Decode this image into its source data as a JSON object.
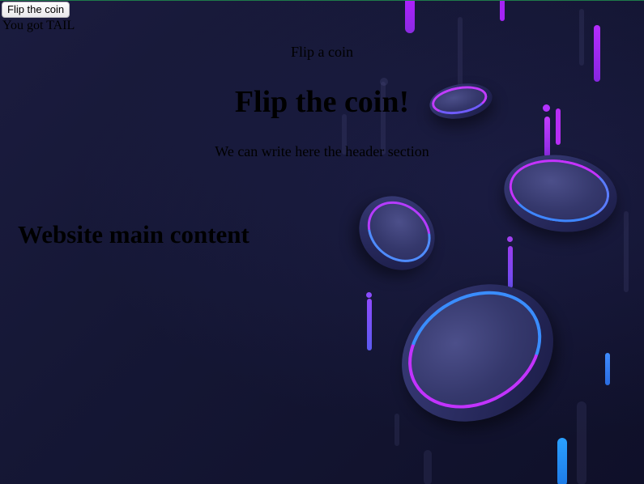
{
  "controls": {
    "flip_button_label": "Flip the coin",
    "result_text": "You got TAIL"
  },
  "header": {
    "small_title": "Flip a coin",
    "title": "Flip the coin!",
    "subtitle": "We can write here the header section"
  },
  "main": {
    "title": "Website main content"
  },
  "theme": {
    "background": "#151735",
    "accent_purple": "#a020f0",
    "accent_blue": "#1e90ff"
  }
}
